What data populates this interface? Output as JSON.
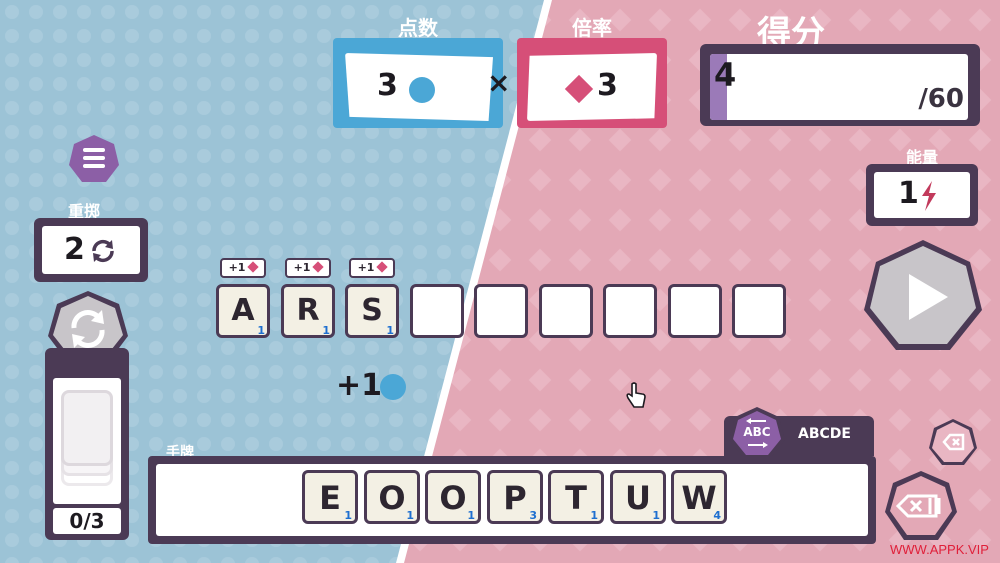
{
  "header": {
    "points_label": "点数",
    "points_value": "3",
    "times_sign": "×",
    "multiplier_label": "倍率",
    "multiplier_value": "3",
    "score_label": "得分",
    "score_current": "4",
    "score_target": "/60",
    "score_progress": 0.0667
  },
  "energy": {
    "label": "能量",
    "value": "1"
  },
  "reroll": {
    "label": "重掷",
    "value": "2"
  },
  "discard_pile": {
    "count": "0/3"
  },
  "word_row": {
    "placed": [
      {
        "letter": "A",
        "points": "1",
        "bonus": "+1"
      },
      {
        "letter": "R",
        "points": "1",
        "bonus": "+1"
      },
      {
        "letter": "S",
        "points": "1",
        "bonus": "+1"
      }
    ],
    "empty_slots": 6,
    "gain_text": "+1"
  },
  "hand": {
    "label": "手牌",
    "sort_icon_text": "ABC",
    "sort_label": "ABCDE",
    "tiles": [
      {
        "letter": "E",
        "points": "1"
      },
      {
        "letter": "O",
        "points": "1"
      },
      {
        "letter": "O",
        "points": "1"
      },
      {
        "letter": "P",
        "points": "3"
      },
      {
        "letter": "T",
        "points": "1"
      },
      {
        "letter": "U",
        "points": "1"
      },
      {
        "letter": "W",
        "points": "4"
      }
    ]
  },
  "watermark": "WWW.APPK.VIP",
  "colors": {
    "blue": "#4ba7d6",
    "pink": "#d64f78",
    "dark": "#4b3a55",
    "bg_blue": "#9cc3d6",
    "bg_pink": "#e3a8b6"
  }
}
